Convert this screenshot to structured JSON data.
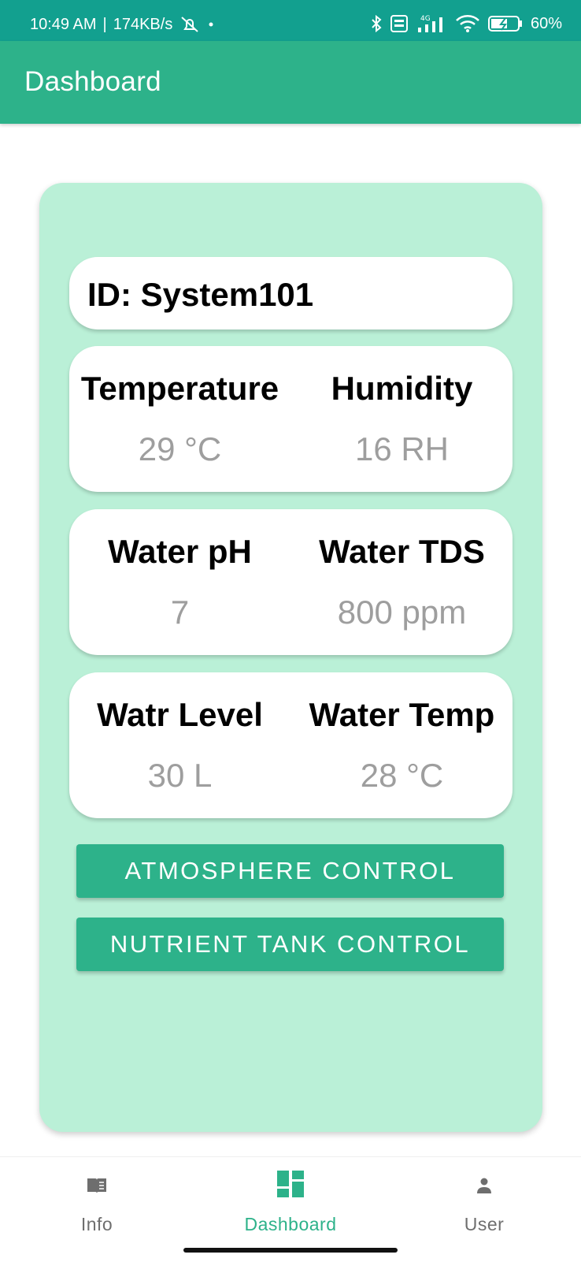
{
  "status_bar": {
    "time": "10:49 AM",
    "separator": "|",
    "network_speed": "174KB/s",
    "network_badge": "4G",
    "volte_badge": "Vo LTE",
    "battery": "60%",
    "icons": [
      "alarm-off-icon",
      "dot-icon",
      "bluetooth-icon",
      "volte-icon",
      "signal-icon",
      "wifi-icon",
      "battery-icon"
    ]
  },
  "app_bar": {
    "title": "Dashboard"
  },
  "system": {
    "id_label": "ID: System101"
  },
  "metrics": [
    {
      "left": {
        "label": "Temperature",
        "value": "29 °C"
      },
      "right": {
        "label": "Humidity",
        "value": "16 RH"
      }
    },
    {
      "left": {
        "label": "Water pH",
        "value": "7"
      },
      "right": {
        "label": "Water TDS",
        "value": "800 ppm"
      }
    },
    {
      "left": {
        "label": "Watr Level",
        "value": "30 L"
      },
      "right": {
        "label": "Water Temp",
        "value": "28 °C"
      }
    }
  ],
  "buttons": {
    "atmosphere": "ATMOSPHERE CONTROL",
    "nutrient": "NUTRIENT TANK CONTROL"
  },
  "bottom_nav": {
    "items": [
      {
        "label": "Info",
        "icon": "book-icon",
        "active": false
      },
      {
        "label": "Dashboard",
        "icon": "dashboard-icon",
        "active": true
      },
      {
        "label": "User",
        "icon": "person-icon",
        "active": false
      }
    ]
  },
  "colors": {
    "status_bar": "#12a08f",
    "primary": "#2db28a",
    "card_background": "#baf0d7",
    "panel_background": "#ffffff",
    "value_text": "#9e9e9e",
    "nav_inactive": "#6e6e6e"
  }
}
